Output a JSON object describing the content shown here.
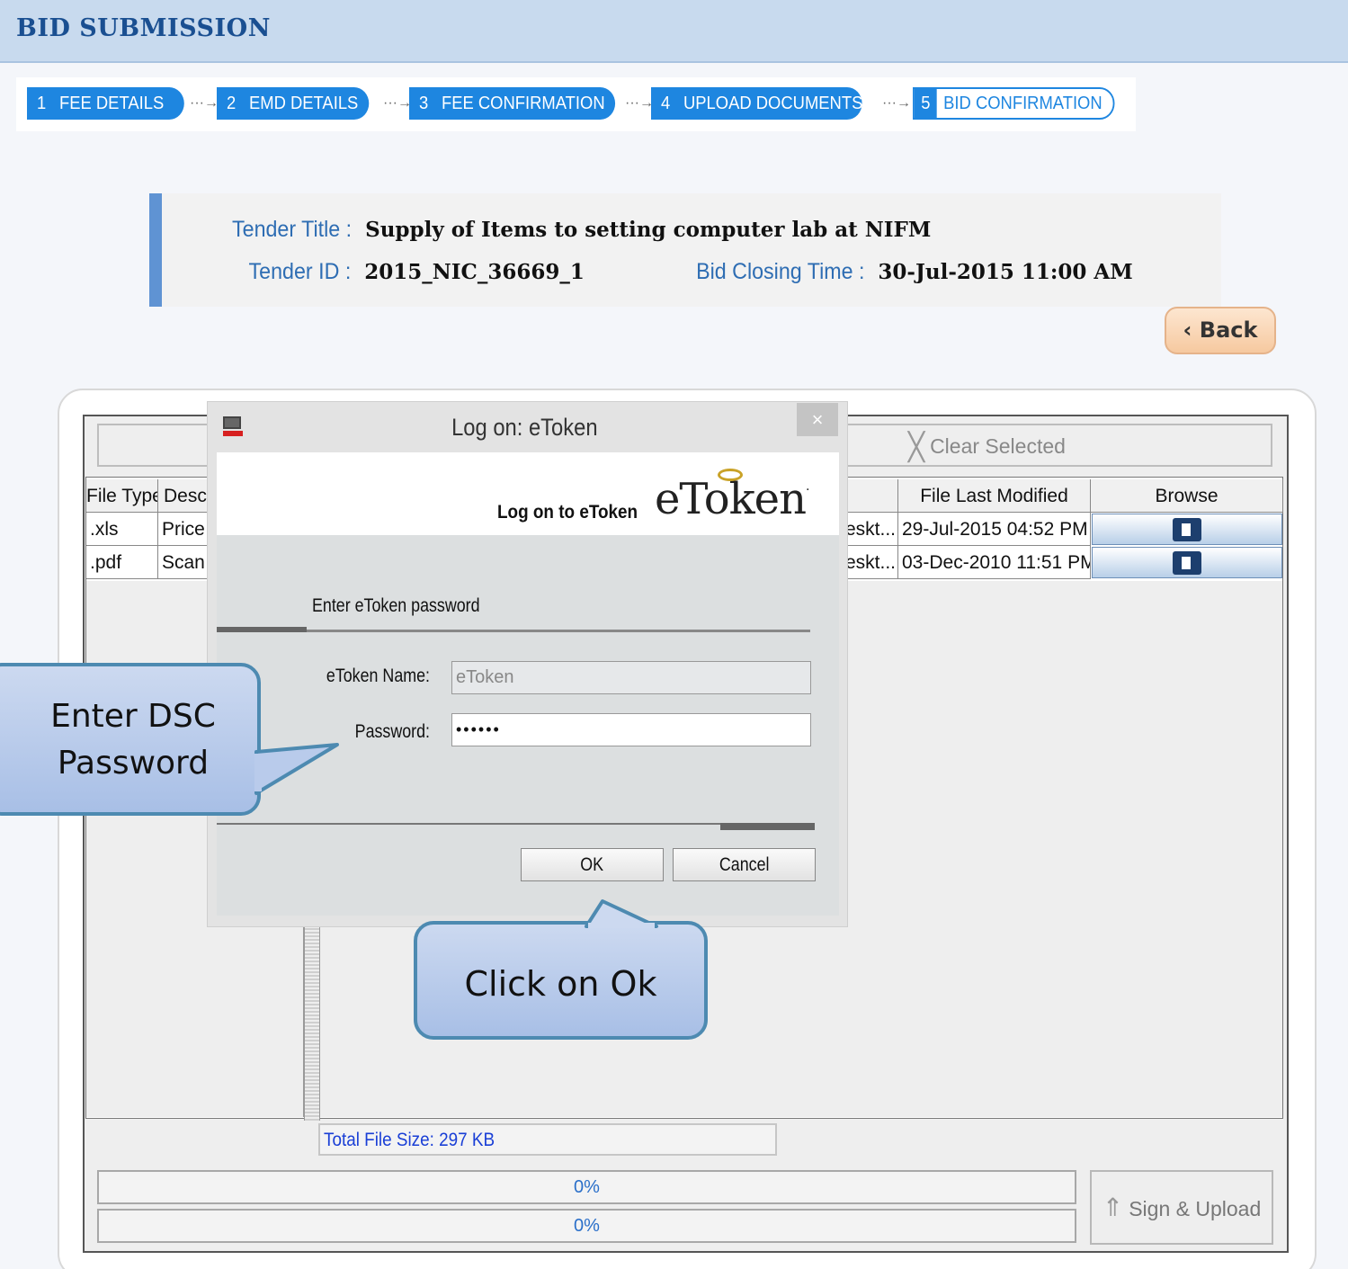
{
  "header": {
    "title": "BID SUBMISSION"
  },
  "steps": [
    {
      "num": "1",
      "label": "FEE DETAILS"
    },
    {
      "num": "2",
      "label": "EMD DETAILS"
    },
    {
      "num": "3",
      "label": "FEE CONFIRMATION"
    },
    {
      "num": "4",
      "label": "UPLOAD DOCUMENTS"
    },
    {
      "num": "5",
      "label": "BID CONFIRMATION"
    }
  ],
  "tender": {
    "title_label": "Tender Title :",
    "title_value": "Supply of Items to setting computer lab at NIFM",
    "id_label": "Tender ID :",
    "id_value": "2015_NIC_36669_1",
    "closing_label": "Bid Closing Time :",
    "closing_value": "30-Jul-2015 11:00 AM"
  },
  "back_button": "Back",
  "toolbar": {
    "clear_selected": "Clear Selected"
  },
  "table": {
    "headers": {
      "file_type": "File Type",
      "description": "Desc",
      "file_last_modified": "File Last Modified",
      "browse": "Browse"
    },
    "rows": [
      {
        "file_type": ".xls",
        "description": "Price E",
        "path": "eskt...",
        "modified": "29-Jul-2015 04:52 PM"
      },
      {
        "file_type": ".pdf",
        "description": "Scan c",
        "path": "eskt...",
        "modified": "03-Dec-2010 11:51 PM"
      }
    ]
  },
  "total_file_size": "Total File Size: 297 KB",
  "progress": [
    "0%",
    "0%"
  ],
  "progress_values": [
    0,
    0
  ],
  "sign_upload": "Sign & Upload",
  "dialog": {
    "title": "Log on: eToken",
    "close": "×",
    "banner_text": "Log on to eToken",
    "logo": "eToken",
    "enter_password_label": "Enter eToken password",
    "name_label": "eToken Name:",
    "name_value": "eToken",
    "password_label": "Password:",
    "password_value": "••••••",
    "ok": "OK",
    "cancel": "Cancel"
  },
  "callouts": {
    "dsc": [
      "Enter DSC",
      "Password"
    ],
    "ok": "Click on Ok"
  }
}
